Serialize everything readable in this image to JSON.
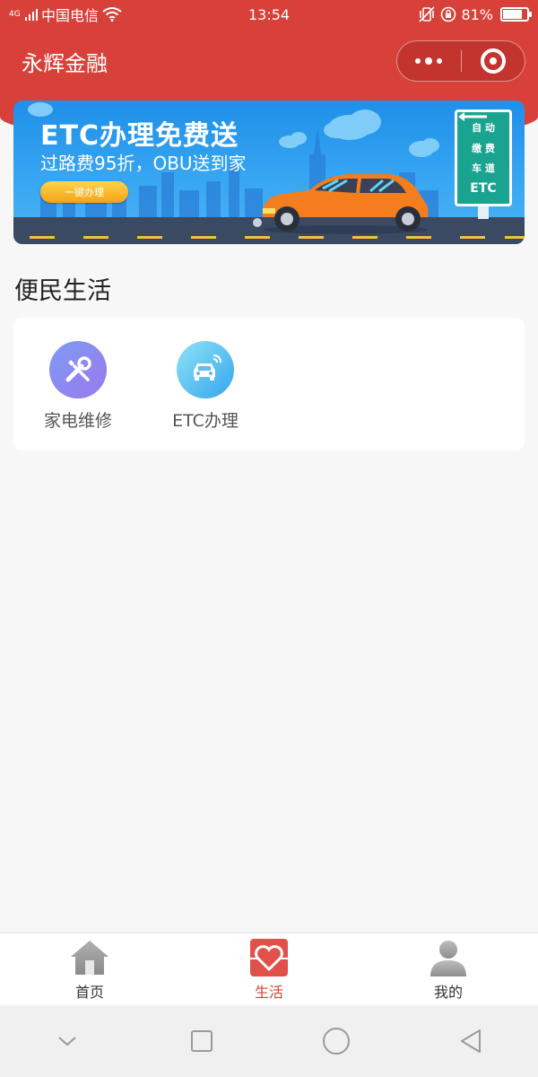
{
  "status_bar": {
    "network": "4G",
    "carrier": "中国电信",
    "time": "13:54",
    "battery": "81%",
    "battery_level": 0.81
  },
  "nav": {
    "title": "永辉金融"
  },
  "banner": {
    "title": "ETC办理免费送",
    "subtitle": "过路费95折，OBU送到家",
    "button": "一键办理",
    "sign_lines": [
      "自 动",
      "缴 费",
      "车 道",
      "ETC"
    ]
  },
  "section": {
    "title": "便民生活"
  },
  "services": [
    {
      "label": "家电维修",
      "icon": "wrench-screwdriver-icon"
    },
    {
      "label": "ETC办理",
      "icon": "car-signal-icon"
    }
  ],
  "tab_bar": {
    "items": [
      {
        "label": "首页",
        "icon": "home-icon",
        "active": false
      },
      {
        "label": "生活",
        "icon": "heart-icon",
        "active": true
      },
      {
        "label": "我的",
        "icon": "user-icon",
        "active": false
      }
    ]
  },
  "colors": {
    "brand_red": "#d8413a",
    "banner_blue": "#1f8fe8",
    "sign_green": "#1aa38f"
  }
}
